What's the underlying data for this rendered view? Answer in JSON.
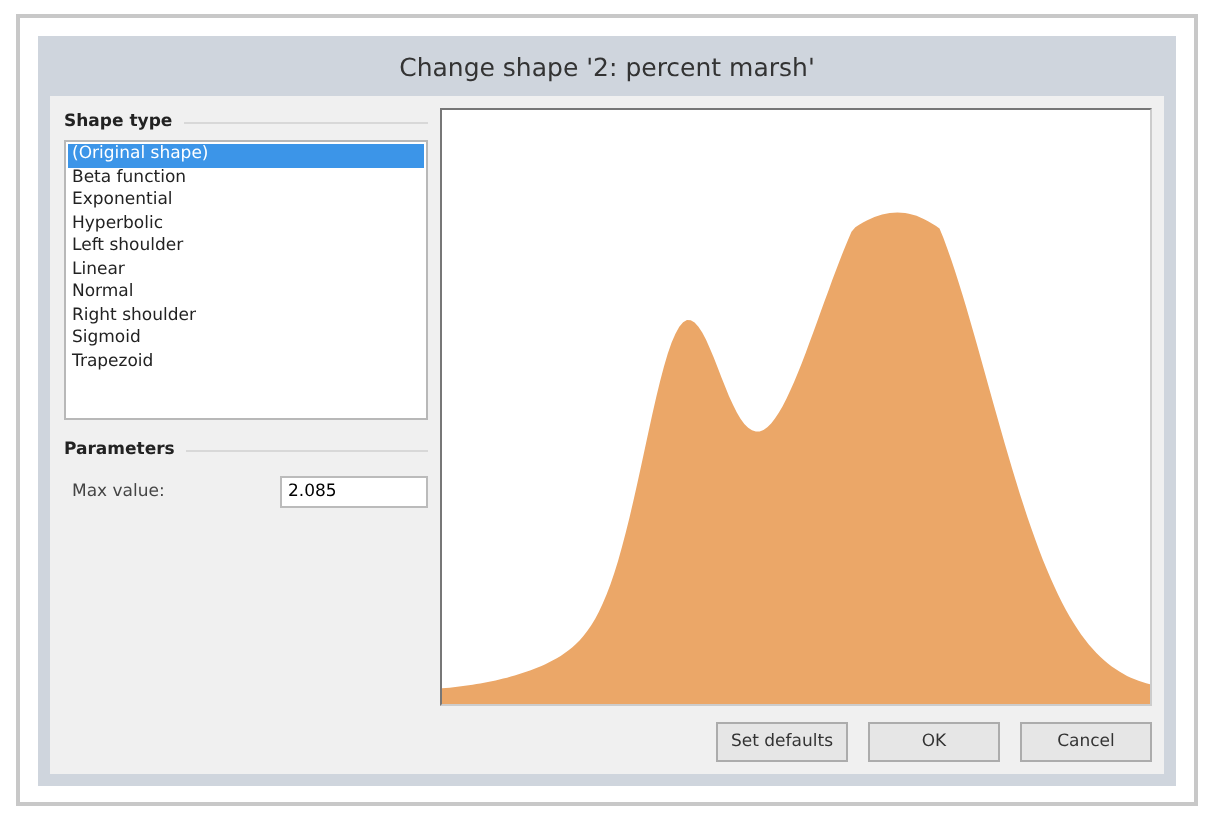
{
  "window": {
    "title": "Change shape '2: percent marsh'"
  },
  "shape_type": {
    "heading": "Shape type",
    "items": [
      {
        "label": "(Original shape)",
        "selected": true
      },
      {
        "label": "Beta function",
        "selected": false
      },
      {
        "label": "Exponential",
        "selected": false
      },
      {
        "label": "Hyperbolic",
        "selected": false
      },
      {
        "label": "Left shoulder",
        "selected": false
      },
      {
        "label": "Linear",
        "selected": false
      },
      {
        "label": "Normal",
        "selected": false
      },
      {
        "label": "Right shoulder",
        "selected": false
      },
      {
        "label": "Sigmoid",
        "selected": false
      },
      {
        "label": "Trapezoid",
        "selected": false
      }
    ]
  },
  "parameters": {
    "heading": "Parameters",
    "fields": [
      {
        "label": "Max value:",
        "value": "2.085"
      }
    ]
  },
  "buttons": [
    "Set defaults",
    "OK",
    "Cancel"
  ]
}
